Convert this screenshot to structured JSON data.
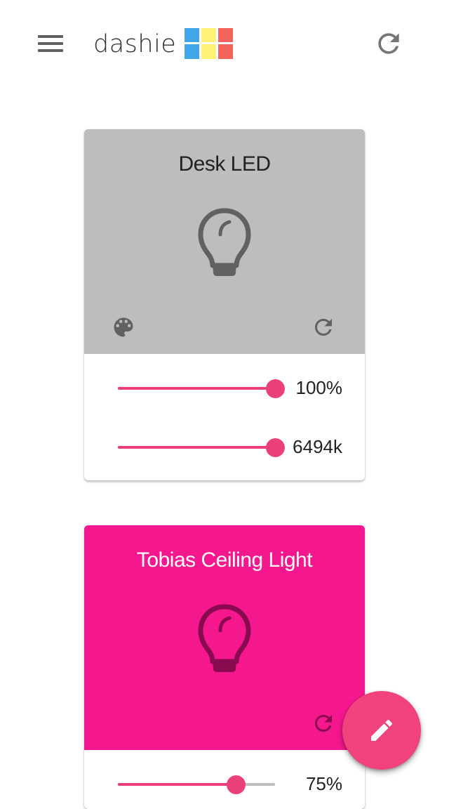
{
  "app": {
    "title": "dashie",
    "logo_colors": [
      "#42a5e5",
      "#fff176",
      "#f4635c"
    ]
  },
  "appbar": {
    "menu_icon": "menu-icon",
    "refresh_icon": "refresh-icon"
  },
  "cards": [
    {
      "name": "Desk LED",
      "state": "off",
      "header_color": "#bdbdbd",
      "name_color": "#212121",
      "bulb_color": "#616161",
      "icons": [
        "lightbulb-icon",
        "palette-icon",
        "refresh-icon"
      ],
      "sliders": [
        {
          "label": "brightness",
          "value_text": "100%",
          "fraction": 1.0
        },
        {
          "label": "color-temperature",
          "value_text": "6494k",
          "fraction": 1.0
        }
      ]
    },
    {
      "name": "Tobias Ceiling Light",
      "state": "on",
      "header_color": "#f5178e",
      "name_color": "#ffffff",
      "bulb_color": "#8a0a4f",
      "icons": [
        "lightbulb-icon",
        "refresh-icon"
      ],
      "sliders": [
        {
          "label": "brightness",
          "value_text": "75%",
          "fraction": 0.75
        }
      ]
    }
  ],
  "fab": {
    "icon": "pencil-icon",
    "color": "#f0437c"
  },
  "accent_color": "#ec407a"
}
